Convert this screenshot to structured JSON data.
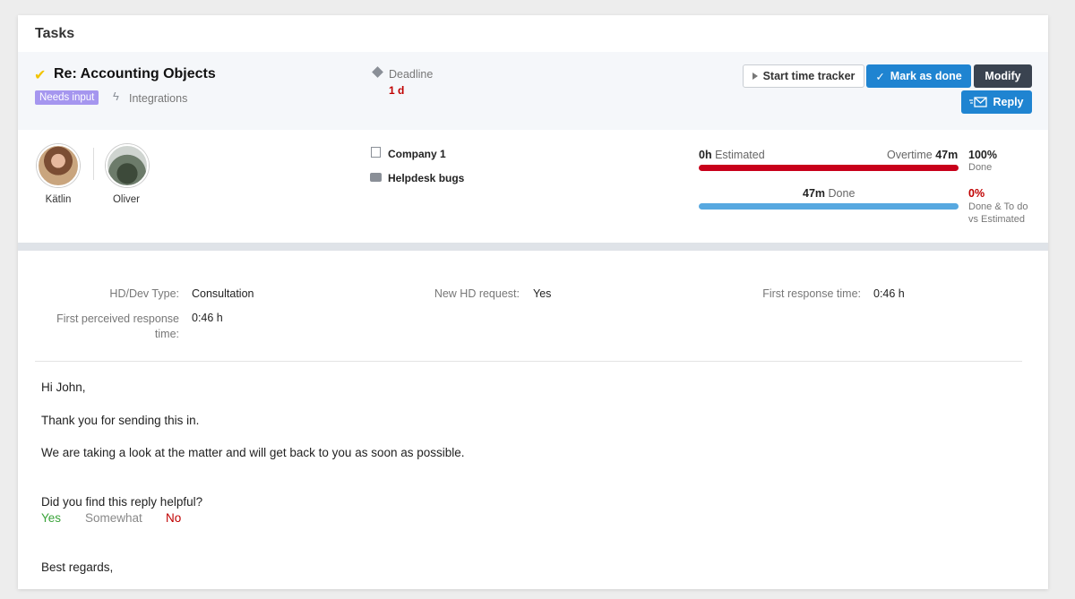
{
  "page": {
    "title": "Tasks"
  },
  "task": {
    "title": "Re: Accounting Objects",
    "status_badge": "Needs input",
    "category": "Integrations",
    "deadline_label": "Deadline",
    "deadline_value": "1 d"
  },
  "actions": {
    "start_tracker": "Start time tracker",
    "mark_done": "Mark as done",
    "modify": "Modify",
    "reply": "Reply"
  },
  "people": [
    {
      "name": "Kätlin"
    },
    {
      "name": "Oliver"
    }
  ],
  "meta": {
    "company": "Company 1",
    "project": "Helpdesk bugs"
  },
  "time": {
    "estimated_value": "0h",
    "estimated_label": "Estimated",
    "overtime_label": "Overtime",
    "overtime_value": "47m",
    "done_value": "47m",
    "done_label": "Done",
    "pct_done": "100%",
    "pct_done_label": "Done",
    "pct_vs": "0%",
    "pct_vs_label": "Done & To do vs Estimated",
    "bar_done_fraction": 1.0,
    "bar_vs_fraction": 1.0
  },
  "fields": [
    {
      "label": "HD/Dev Type:",
      "value": "Consultation"
    },
    {
      "label": "New HD request:",
      "value": "Yes"
    },
    {
      "label": "First response time:",
      "value": "0:46 h"
    },
    {
      "label": "First perceived response time:",
      "value": "0:46 h"
    }
  ],
  "message": {
    "greeting": "Hi John,",
    "line1": "Thank you for sending this in.",
    "line2": "We are taking a look at the matter and will get back to you as soon as possible.",
    "feedback_question": "Did you find this reply helpful?",
    "feedback_yes": "Yes",
    "feedback_somewhat": "Somewhat",
    "feedback_no": "No",
    "closing": "Best regards,"
  },
  "colors": {
    "primary": "#1f84d1",
    "dark": "#3a4350",
    "badge": "#a596ef",
    "danger": "#c00000",
    "estimate_bar": "#c8001a",
    "done_bar": "#57a8e0",
    "feedback_yes": "#3aa33a",
    "feedback_somewhat": "#888888"
  }
}
